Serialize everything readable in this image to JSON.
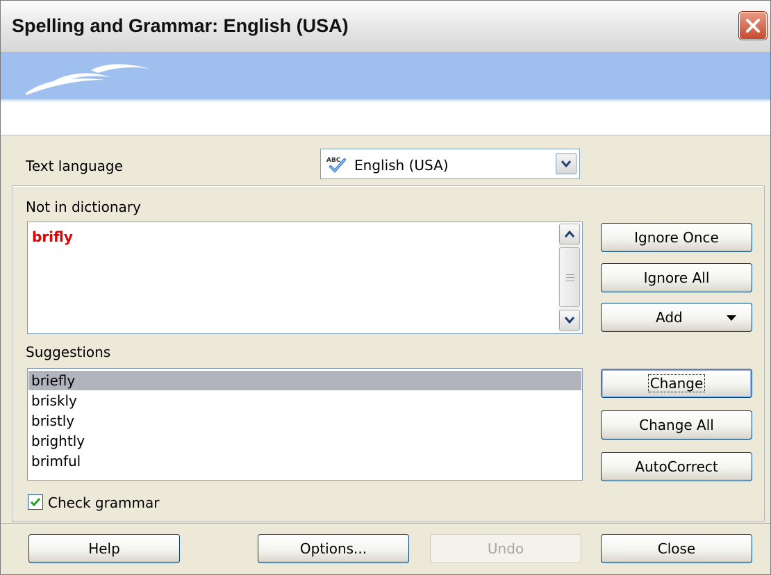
{
  "window": {
    "title": "Spelling and Grammar: English (USA)"
  },
  "text_language": {
    "label": "Text language",
    "value": "English (USA)"
  },
  "not_in_dictionary": {
    "label": "Not in dictionary",
    "word": "brifly"
  },
  "suggestions": {
    "label": "Suggestions",
    "items": [
      "briefly",
      "briskly",
      "bristly",
      "brightly",
      "brimful"
    ],
    "selected": "briefly"
  },
  "buttons": {
    "ignore_once": "Ignore Once",
    "ignore_all": "Ignore All",
    "add": "Add",
    "change": "Change",
    "change_all": "Change All",
    "autocorrect": "AutoCorrect",
    "help": "Help",
    "options": "Options...",
    "undo": "Undo",
    "close": "Close"
  },
  "check_grammar": {
    "label": "Check grammar",
    "checked": true
  },
  "colors": {
    "misspelled_word": "#e00000",
    "banner": "#9fbfee",
    "selection": "#b1b3bd"
  }
}
